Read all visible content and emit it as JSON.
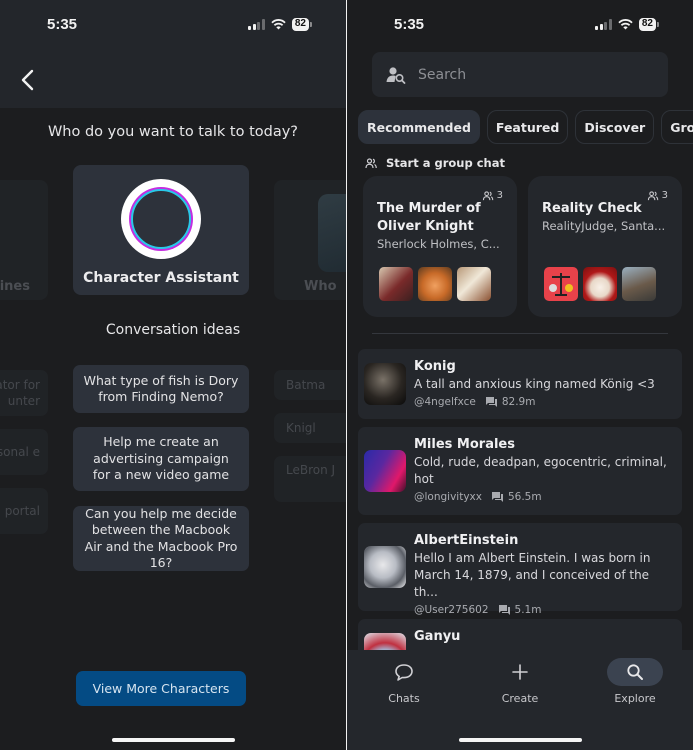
{
  "status_bar": {
    "time": "5:35",
    "battery": "82"
  },
  "left_screen": {
    "prompt": "Who do you want to talk to today?",
    "characters": [
      {
        "name": "lines",
        "state": "partial-left"
      },
      {
        "name": "Character Assistant",
        "state": "selected"
      },
      {
        "name": "Who",
        "state": "partial-right"
      }
    ],
    "ideas_title": "Conversation ideas",
    "ideas_main": [
      "What type of fish is Dory from Finding Nemo?",
      "Help me create an advertising campaign for a new video game",
      "Can you help me decide between the Macbook Air and the Macbook Pro 16?"
    ],
    "ideas_left": [
      "ator for unter",
      "ersonal e",
      "portal"
    ],
    "ideas_right": [
      "Batma",
      "Knigl",
      "LeBron J"
    ],
    "view_more": "View More Characters",
    "colors": {
      "accent_button": "#044b84",
      "ring_cyan": "#29c9e8",
      "ring_magenta": "#c42de0"
    }
  },
  "right_screen": {
    "search_placeholder": "Search",
    "tabs": [
      {
        "label": "Recommended",
        "active": true
      },
      {
        "label": "Featured",
        "active": false
      },
      {
        "label": "Discover",
        "active": false
      },
      {
        "label": "Groups",
        "active": false
      }
    ],
    "group_chat_label": "Start a group chat",
    "group_cards": [
      {
        "title": "The Murder of Oliver Knight",
        "members": "Sherlock Holmes, C...",
        "count": "3"
      },
      {
        "title": "Reality Check",
        "members": "RealityJudge, Santa...",
        "count": "3"
      }
    ],
    "characters": [
      {
        "name": "Konig",
        "description": "A tall and anxious king named König <3",
        "creator": "@4ngelfxce",
        "chats": "82.9m"
      },
      {
        "name": "Miles Morales",
        "description": "Cold, rude, deadpan, egocentric, criminal, hot",
        "creator": "@longivityxx",
        "chats": "56.5m"
      },
      {
        "name": "AlbertEinstein",
        "description": "Hello I am Albert Einstein. I was born in March 14, 1879, and I conceived of the th...",
        "creator": "@User275602",
        "chats": "5.1m"
      },
      {
        "name": "Ganyu",
        "description": "",
        "creator": "",
        "chats": ""
      }
    ],
    "nav": [
      {
        "label": "Chats",
        "icon": "chat-bubble-icon",
        "active": false
      },
      {
        "label": "Create",
        "icon": "plus-icon",
        "active": false
      },
      {
        "label": "Explore",
        "icon": "search-icon",
        "active": true
      }
    ]
  }
}
